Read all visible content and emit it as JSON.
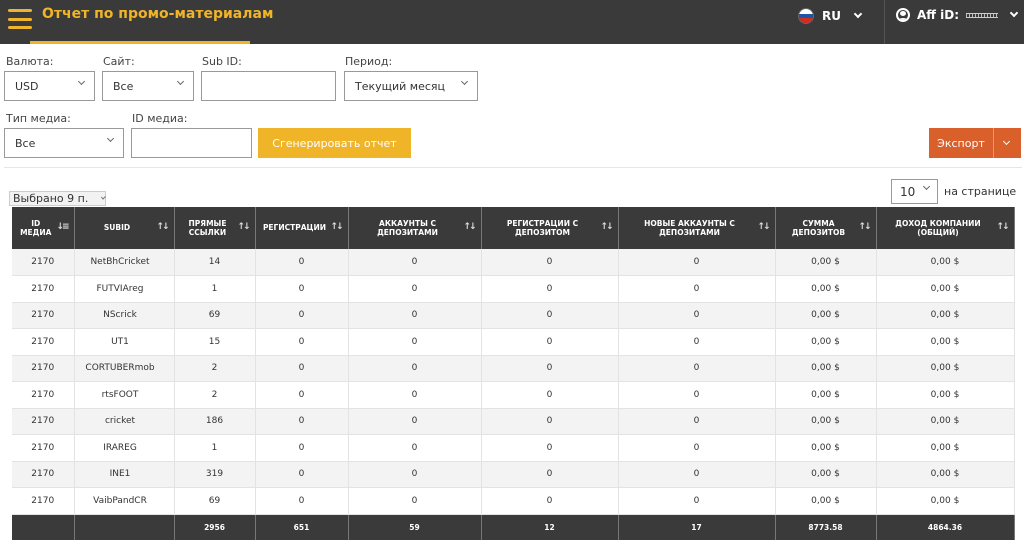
{
  "header": {
    "title": "Отчет по промо-материалам",
    "language": "RU",
    "aff_label": "Aff iD:"
  },
  "filters": {
    "currency": {
      "label": "Валюта:",
      "value": "USD"
    },
    "site": {
      "label": "Сайт:",
      "value": "Все"
    },
    "subid": {
      "label": "Sub ID:",
      "value": ""
    },
    "period": {
      "label": "Период:",
      "value": "Текущий месяц"
    },
    "media_type": {
      "label": "Тип медиа:",
      "value": "Все"
    },
    "media_id": {
      "label": "ID медиа:",
      "value": ""
    }
  },
  "actions": {
    "generate": "Сгенерировать отчет",
    "export": "Экспорт"
  },
  "table_controls": {
    "selected": "Выбрано 9 п.",
    "per_page_value": "10",
    "per_page_label": "на странице"
  },
  "columns": [
    "ID медиа",
    "SubID",
    "Прямые ссылки",
    "Регистрации",
    "Аккаунты с депозитами",
    "Регистрации с депозитом",
    "Новые аккаунты с депозитами",
    "Сумма депозитов",
    "Доход компании (общий)"
  ],
  "rows": [
    [
      "2170",
      "NetBhCricket",
      "14",
      "0",
      "0",
      "0",
      "0",
      "0,00 $",
      "0,00 $"
    ],
    [
      "2170",
      "FUTVIAreg",
      "1",
      "0",
      "0",
      "0",
      "0",
      "0,00 $",
      "0,00 $"
    ],
    [
      "2170",
      "NScrick",
      "69",
      "0",
      "0",
      "0",
      "0",
      "0,00 $",
      "0,00 $"
    ],
    [
      "2170",
      "UT1",
      "15",
      "0",
      "0",
      "0",
      "0",
      "0,00 $",
      "0,00 $"
    ],
    [
      "2170",
      "CORTUBERmob",
      "2",
      "0",
      "0",
      "0",
      "0",
      "0,00 $",
      "0,00 $"
    ],
    [
      "2170",
      "rtsFOOT",
      "2",
      "0",
      "0",
      "0",
      "0",
      "0,00 $",
      "0,00 $"
    ],
    [
      "2170",
      "cricket",
      "186",
      "0",
      "0",
      "0",
      "0",
      "0,00 $",
      "0,00 $"
    ],
    [
      "2170",
      "IRAREG",
      "1",
      "0",
      "0",
      "0",
      "0",
      "0,00 $",
      "0,00 $"
    ],
    [
      "2170",
      "INE1",
      "319",
      "0",
      "0",
      "0",
      "0",
      "0,00 $",
      "0,00 $"
    ],
    [
      "2170",
      "VaibPandCR",
      "69",
      "0",
      "0",
      "0",
      "0",
      "0,00 $",
      "0,00 $"
    ]
  ],
  "totals": [
    "",
    "",
    "2956",
    "651",
    "59",
    "12",
    "17",
    "8773.58",
    "4864.36"
  ],
  "colors": {
    "accent": "#f0b429",
    "export": "#d95f2b",
    "dark": "#3a3a3a"
  }
}
